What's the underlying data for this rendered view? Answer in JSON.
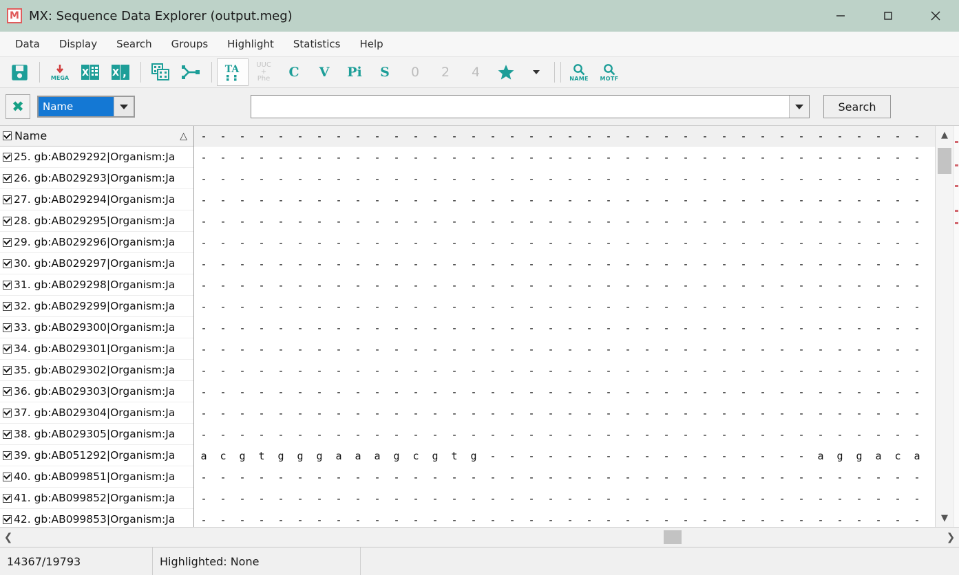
{
  "window": {
    "title": "MX: Sequence Data Explorer (output.meg)",
    "logo_text": "M",
    "titlebar_color": "#bdd2c8",
    "accent_color": "#1d9e98",
    "controls": {
      "minimize": "minimize-icon",
      "maximize": "maximize-icon",
      "close": "close-icon"
    }
  },
  "menubar": {
    "items": [
      {
        "label": "Data"
      },
      {
        "label": "Display"
      },
      {
        "label": "Search"
      },
      {
        "label": "Groups"
      },
      {
        "label": "Highlight"
      },
      {
        "label": "Statistics"
      },
      {
        "label": "Help"
      }
    ]
  },
  "toolbar": {
    "items": [
      {
        "icon": "save-icon",
        "label": "",
        "enabled": true
      },
      {
        "icon": "export-mega-icon",
        "label": "MEGA",
        "enabled": true
      },
      {
        "icon": "export-excel-icon",
        "label": "X",
        "enabled": true
      },
      {
        "icon": "export-csv-icon",
        "label": "X",
        "enabled": true
      },
      {
        "icon": "stacked-grids-icon",
        "label": "",
        "enabled": true
      },
      {
        "icon": "phylogeny-tree-icon",
        "label": "",
        "enabled": true
      },
      {
        "icon": "translate-ta-icon",
        "label": "TA",
        "enabled": true
      },
      {
        "icon": "codon-uuc-phe-icon",
        "label": "UUC Phe",
        "enabled": false
      },
      {
        "icon": "letter-c-icon",
        "label": "C",
        "enabled": true
      },
      {
        "icon": "letter-v-icon",
        "label": "V",
        "enabled": true
      },
      {
        "icon": "letter-pi-icon",
        "label": "Pi",
        "enabled": true
      },
      {
        "icon": "letter-s-icon",
        "label": "S",
        "enabled": true
      },
      {
        "icon": "codon-pos-0-icon",
        "label": "0",
        "enabled": false
      },
      {
        "icon": "codon-pos-2-icon",
        "label": "2",
        "enabled": false
      },
      {
        "icon": "codon-pos-4-icon",
        "label": "4",
        "enabled": false
      },
      {
        "icon": "star-icon",
        "label": "",
        "enabled": true
      },
      {
        "icon": "star-dropdown-icon",
        "label": "",
        "enabled": true
      },
      {
        "icon": "search-name-icon",
        "label": "NAME",
        "enabled": true
      },
      {
        "icon": "search-motif-icon",
        "label": "MOTF",
        "enabled": true
      }
    ]
  },
  "searchbar": {
    "close_icon": "close-x-icon",
    "field_selector": {
      "selected": "Name",
      "options": [
        "Name",
        "Motif"
      ]
    },
    "query": {
      "value": "",
      "placeholder": ""
    },
    "search_button": "Search"
  },
  "grid": {
    "name_column": {
      "header": "Name",
      "sort_indicator": "△",
      "header_checked": true
    },
    "rows": [
      {
        "index": "25.",
        "name": "gb:AB029292|Organism:Ja",
        "checked": true
      },
      {
        "index": "26.",
        "name": "gb:AB029293|Organism:Ja",
        "checked": true
      },
      {
        "index": "27.",
        "name": "gb:AB029294|Organism:Ja",
        "checked": true
      },
      {
        "index": "28.",
        "name": "gb:AB029295|Organism:Ja",
        "checked": true
      },
      {
        "index": "29.",
        "name": "gb:AB029296|Organism:Ja",
        "checked": true
      },
      {
        "index": "30.",
        "name": "gb:AB029297|Organism:Ja",
        "checked": true
      },
      {
        "index": "31.",
        "name": "gb:AB029298|Organism:Ja",
        "checked": true
      },
      {
        "index": "32.",
        "name": "gb:AB029299|Organism:Ja",
        "checked": true
      },
      {
        "index": "33.",
        "name": "gb:AB029300|Organism:Ja",
        "checked": true
      },
      {
        "index": "34.",
        "name": "gb:AB029301|Organism:Ja",
        "checked": true
      },
      {
        "index": "35.",
        "name": "gb:AB029302|Organism:Ja",
        "checked": true
      },
      {
        "index": "36.",
        "name": "gb:AB029303|Organism:Ja",
        "checked": true
      },
      {
        "index": "37.",
        "name": "gb:AB029304|Organism:Ja",
        "checked": true
      },
      {
        "index": "38.",
        "name": "gb:AB029305|Organism:Ja",
        "checked": true
      },
      {
        "index": "39.",
        "name": "gb:AB051292|Organism:Ja",
        "checked": true
      },
      {
        "index": "40.",
        "name": "gb:AB099851|Organism:Ja",
        "checked": true
      },
      {
        "index": "41.",
        "name": "gb:AB099852|Organism:Ja",
        "checked": true
      },
      {
        "index": "42.",
        "name": "gb:AB099853|Organism:Ja",
        "checked": true
      }
    ],
    "sequences": [
      "--------------------------------------",
      "--------------------------------------",
      "--------------------------------------",
      "--------------------------------------",
      "--------------------------------------",
      "--------------------------------------",
      "--------------------------------------",
      "--------------------------------------",
      "--------------------------------------",
      "--------------------------------------",
      "--------------------------------------",
      "--------------------------------------",
      "--------------------------------------",
      "--------------------------------------",
      "acgtgggaaagcgtg-----------------aggaca",
      "--------------------------------------",
      "--------------------------------------",
      "--------------------------------------"
    ],
    "header_sequence": "--------------------------------------",
    "scrollbars": {
      "vertical_up": "chevron-up-icon",
      "vertical_down": "chevron-down-icon",
      "horizontal_left": "chevron-left-icon",
      "horizontal_right": "chevron-right-icon"
    }
  },
  "statusbar": {
    "position": "14367/19793",
    "highlighted": "Highlighted: None",
    "extra": ""
  }
}
